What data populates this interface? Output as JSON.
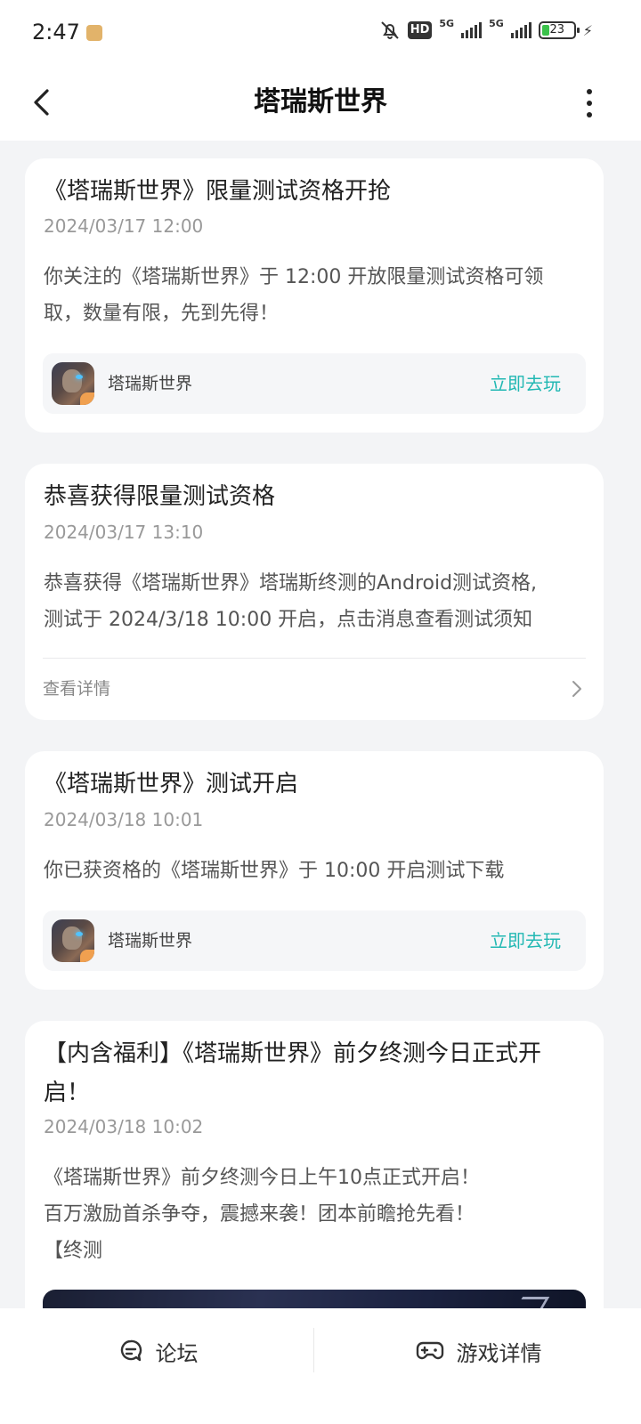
{
  "status_bar": {
    "time": "2:47",
    "hd_label": "HD",
    "network_1": "5G",
    "network_2": "5G",
    "battery": "23"
  },
  "header": {
    "title": "塔瑞斯世界"
  },
  "messages": [
    {
      "title": "《塔瑞斯世界》限量测试资格开抢",
      "time": "2024/03/17 12:00",
      "body_line1": "你关注的《塔瑞斯世界》于 12:00 开放限量测试资格可领",
      "body_line2": "取，数量有限，先到先得！",
      "game_name": "塔瑞斯世界",
      "action_label": "立即去玩"
    },
    {
      "title": "恭喜获得限量测试资格",
      "time": "2024/03/17 13:10",
      "body_line1": "恭喜获得《塔瑞斯世界》塔瑞斯终测的Android测试资格,",
      "body_line2": "测试于 2024/3/18 10:00 开启，点击消息查看测试须知",
      "detail_label": "查看详情"
    },
    {
      "title": "《塔瑞斯世界》测试开启",
      "time": "2024/03/18 10:01",
      "body_line1": "你已获资格的《塔瑞斯世界》于 10:00 开启测试下载",
      "game_name": "塔瑞斯世界",
      "action_label": "立即去玩"
    },
    {
      "title_line1": "【内含福利】《塔瑞斯世界》前夕终测今日正式开",
      "title_line2": "启！",
      "time": "2024/03/18 10:02",
      "body_line1": "《塔瑞斯世界》前夕终测今日上午10点正式开启！",
      "body_line2": "百万激励首杀争夺，震撼来袭！团本前瞻抢先看！",
      "body_line3": "【终测"
    }
  ],
  "bottom_bar": {
    "forum_label": "论坛",
    "game_detail_label": "游戏详情"
  },
  "colors": {
    "accent": "#22b8b3",
    "background": "#f3f4f6",
    "card": "#ffffff"
  }
}
